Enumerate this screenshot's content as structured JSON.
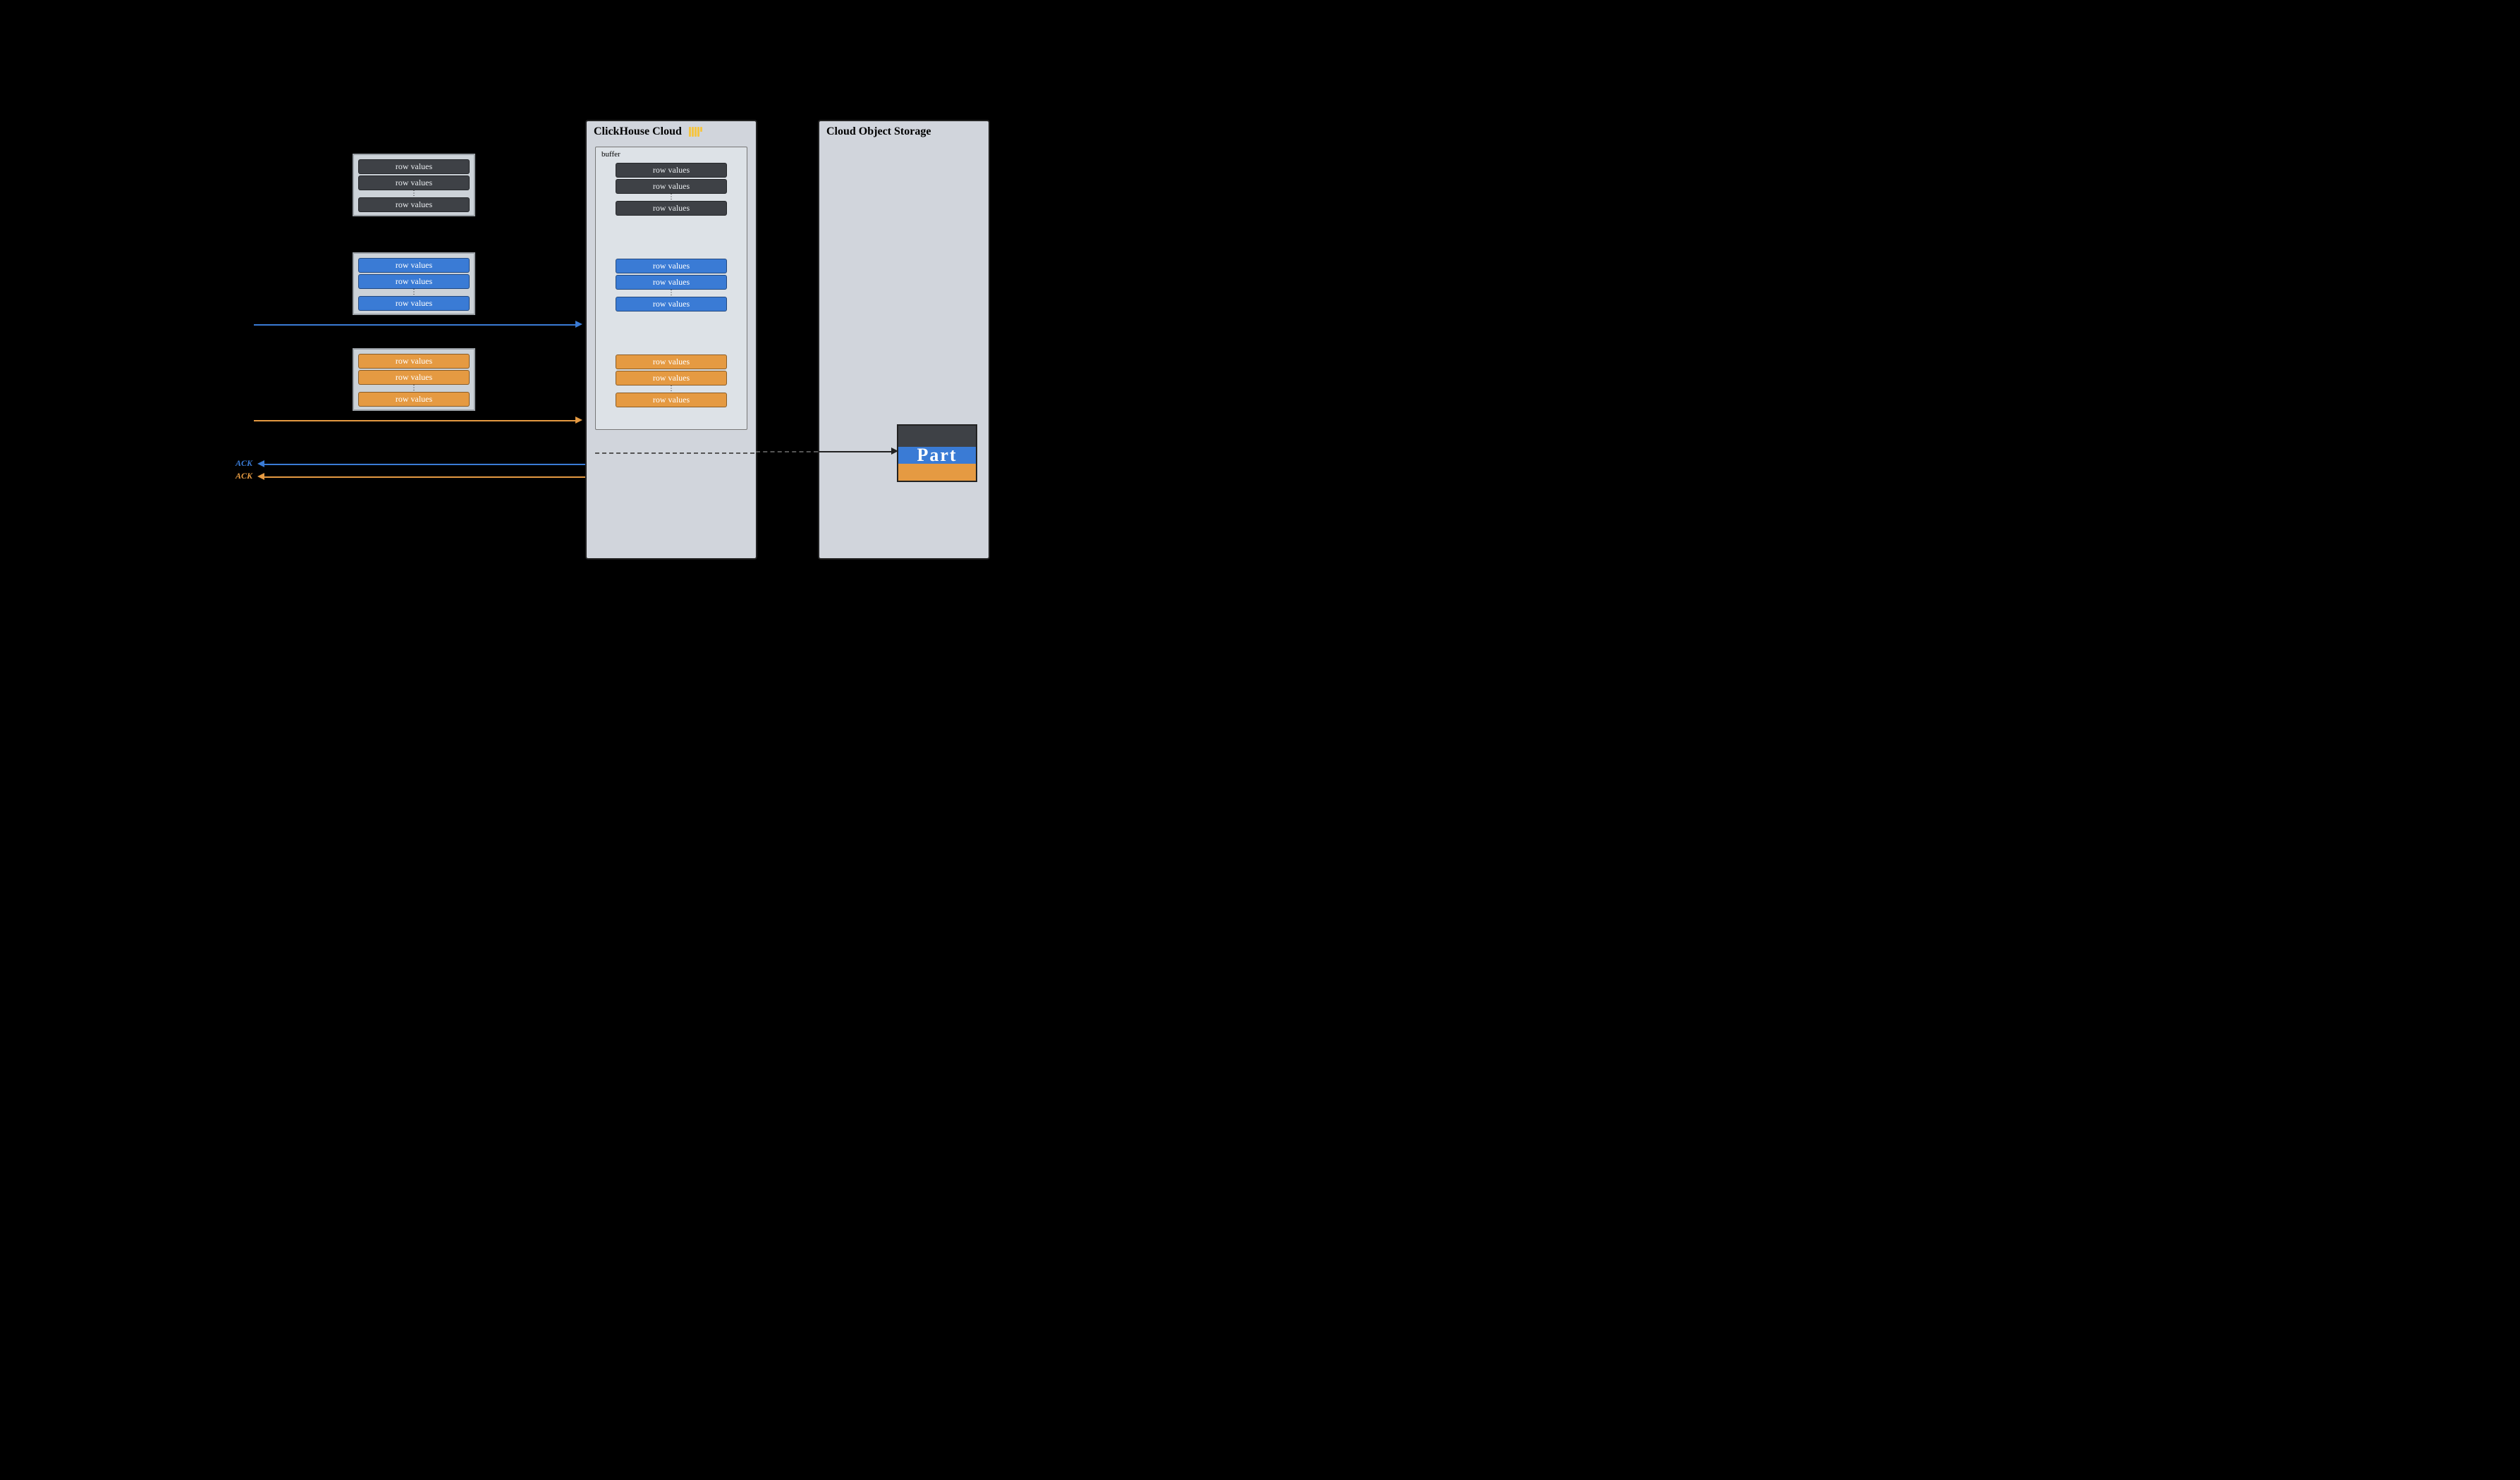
{
  "panels": {
    "clickhouse": {
      "title": "ClickHouse Cloud"
    },
    "storage": {
      "title": "Cloud Object Storage"
    }
  },
  "buffer": {
    "label": "buffer"
  },
  "rowLabel": "row values",
  "ack": {
    "blue": "ACK",
    "orange": "ACK"
  },
  "part": {
    "label": "Part"
  },
  "colors": {
    "dark": "#3e4146",
    "blue": "#3a7bd5",
    "orange": "#e59a42"
  }
}
